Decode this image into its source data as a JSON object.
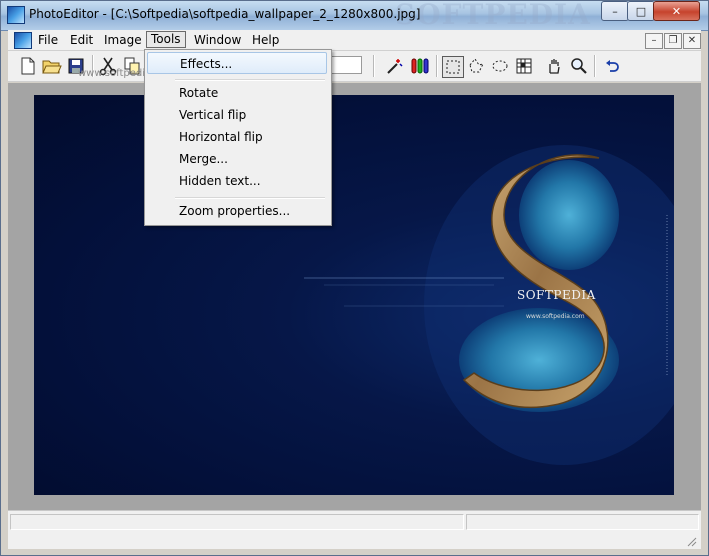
{
  "window": {
    "title": "PhotoEditor - [C:\\Softpedia\\softpedia_wallpaper_2_1280x800.jpg]",
    "watermark": "SOFTPEDIA",
    "caption_buttons": {
      "minimize": "–",
      "maximize": "□",
      "close": "✕"
    }
  },
  "menubar": {
    "items": [
      "File",
      "Edit",
      "Image",
      "Tools",
      "Window",
      "Help"
    ],
    "open_item": "Tools",
    "mdi_buttons": {
      "minimize": "–",
      "restore": "❐",
      "close": "✕"
    }
  },
  "tools_menu": {
    "items": [
      "Effects...",
      "Rotate",
      "Vertical flip",
      "Horizontal flip",
      "Merge...",
      "Hidden text...",
      "Zoom properties..."
    ],
    "highlighted": "Effects..."
  },
  "toolbar": {
    "icons": [
      "new-icon",
      "open-icon",
      "save-icon",
      "cut-icon",
      "copy-icon",
      "magic-wand-icon",
      "color-channels-icon",
      "rect-select-icon",
      "lasso-select-icon",
      "ellipse-select-icon",
      "pattern-icon",
      "hand-pan-icon",
      "zoom-icon",
      "undo-icon"
    ]
  },
  "canvas": {
    "image_text": "SOFTPEDIA",
    "image_url_text": "www.softpedia.com",
    "watermark_text": "www.softpedia.com",
    "colors": {
      "background": "#03103a",
      "land": "#b08a5a",
      "water": "#2f8fc0"
    }
  }
}
